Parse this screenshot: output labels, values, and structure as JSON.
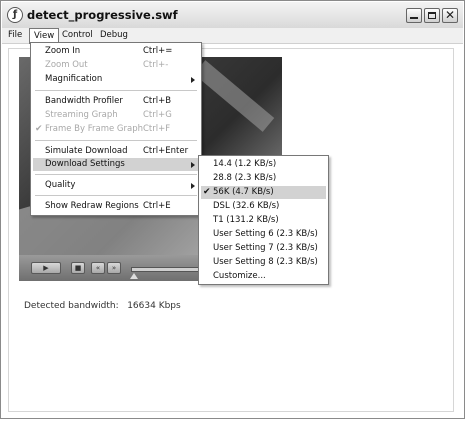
{
  "window": {
    "title": "detect_progressive.swf"
  },
  "menubar": {
    "items": [
      "File",
      "View",
      "Control",
      "Debug"
    ]
  },
  "view_menu": {
    "items": [
      {
        "label": "Zoom In",
        "shortcut": "Ctrl+="
      },
      {
        "label": "Zoom Out",
        "shortcut": "Ctrl+-",
        "disabled": true
      },
      {
        "label": "Magnification",
        "submenu": true
      },
      {
        "label": "Bandwidth Profiler",
        "shortcut": "Ctrl+B"
      },
      {
        "label": "Streaming Graph",
        "shortcut": "Ctrl+G",
        "disabled": true
      },
      {
        "label": "Frame By Frame Graph",
        "shortcut": "Ctrl+F",
        "disabled": true,
        "checked": true
      },
      {
        "label": "Simulate Download",
        "shortcut": "Ctrl+Enter"
      },
      {
        "label": "Download Settings",
        "submenu": true,
        "highlighted": true
      },
      {
        "label": "Quality",
        "submenu": true
      },
      {
        "label": "Show Redraw Regions",
        "shortcut": "Ctrl+E"
      }
    ]
  },
  "download_settings_menu": {
    "items": [
      {
        "label": "14.4 (1.2 KB/s)"
      },
      {
        "label": "28.8 (2.3 KB/s)"
      },
      {
        "label": "56K (4.7 KB/s)",
        "checked": true,
        "highlighted": true
      },
      {
        "label": "DSL (32.6 KB/s)"
      },
      {
        "label": "T1 (131.2 KB/s)"
      },
      {
        "label": "User Setting 6 (2.3 KB/s)"
      },
      {
        "label": "User Setting 7 (2.3 KB/s)"
      },
      {
        "label": "User Setting 8 (2.3 KB/s)"
      },
      {
        "label": "Customize..."
      }
    ]
  },
  "status": {
    "label": "Detected bandwidth:",
    "value": "16634 Kbps"
  },
  "check_mark": "✔"
}
